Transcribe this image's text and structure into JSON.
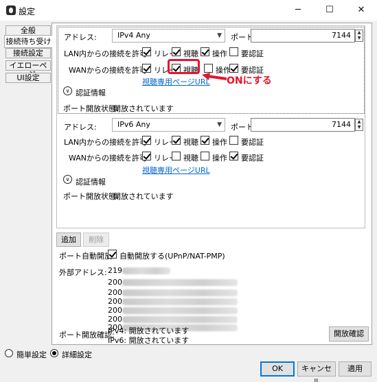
{
  "window": {
    "title": "設定",
    "minimize": "─",
    "maximize": "☐",
    "close": "✕"
  },
  "tabs": [
    "全般",
    "接続待ち受け",
    "接続設定",
    "イエローページ",
    "UI設定"
  ],
  "entries": [
    {
      "address_label": "アドレス:",
      "address_value": "IPv4 Any",
      "port_label": "ポート:",
      "port_value": "7144",
      "lan_label": "LAN内からの接続を許可:",
      "lan_checks": [
        {
          "label": "リレー",
          "checked": true
        },
        {
          "label": "視聴",
          "checked": true
        },
        {
          "label": "操作",
          "checked": true
        },
        {
          "label": "要認証",
          "checked": false
        }
      ],
      "wan_label": "WANからの接続を許可:",
      "wan_checks": [
        {
          "label": "リレー",
          "checked": true
        },
        {
          "label": "視聴",
          "checked": true
        },
        {
          "label": "操作",
          "checked": false
        },
        {
          "label": "要認証",
          "checked": true
        }
      ],
      "link": "視聴専用ページURL",
      "auth_label": "認証情報",
      "status_label": "ポート開放状態:",
      "status_value": "開放されています"
    },
    {
      "address_label": "アドレス:",
      "address_value": "IPv6 Any",
      "port_label": "ポート:",
      "port_value": "7144",
      "lan_label": "LAN内からの接続を許可:",
      "lan_checks": [
        {
          "label": "リレー",
          "checked": true
        },
        {
          "label": "視聴",
          "checked": true
        },
        {
          "label": "操作",
          "checked": true
        },
        {
          "label": "要認証",
          "checked": false
        }
      ],
      "wan_label": "WANからの接続を許可:",
      "wan_checks": [
        {
          "label": "リレー",
          "checked": true
        },
        {
          "label": "視聴",
          "checked": false
        },
        {
          "label": "操作",
          "checked": false
        },
        {
          "label": "要認証",
          "checked": true
        }
      ],
      "link": "視聴専用ページURL",
      "auth_label": "認証情報",
      "status_label": "ポート開放状態:",
      "status_value": "開放されています"
    }
  ],
  "annotation": {
    "text": "ONにする",
    "color": "#e8132b"
  },
  "list_buttons": {
    "add": "追加",
    "delete": "削除"
  },
  "auto_open": {
    "label": "ポート自動開放:",
    "checkbox_label": "自動開放する(UPnP/NAT-PMP)",
    "checked": true
  },
  "external": {
    "label": "外部アドレス:",
    "ipv4_prefix": "219",
    "ipv6_prefixes": [
      "200",
      "200",
      "200",
      "200",
      "200",
      "200"
    ]
  },
  "port_check": {
    "label": "ポート開放確認:",
    "ipv4": "IPv4: 開放されています",
    "ipv6": "IPv6: 開放されています",
    "button": "開放確認"
  },
  "mode": {
    "simple": "簡単設定",
    "detail": "詳細設定",
    "selected": "detail"
  },
  "footer": {
    "ok": "OK",
    "cancel": "キャンセル",
    "apply": "適用"
  },
  "colors": {
    "link": "#0066cc",
    "accent": "#0078d7",
    "highlight": "#e8132b"
  }
}
